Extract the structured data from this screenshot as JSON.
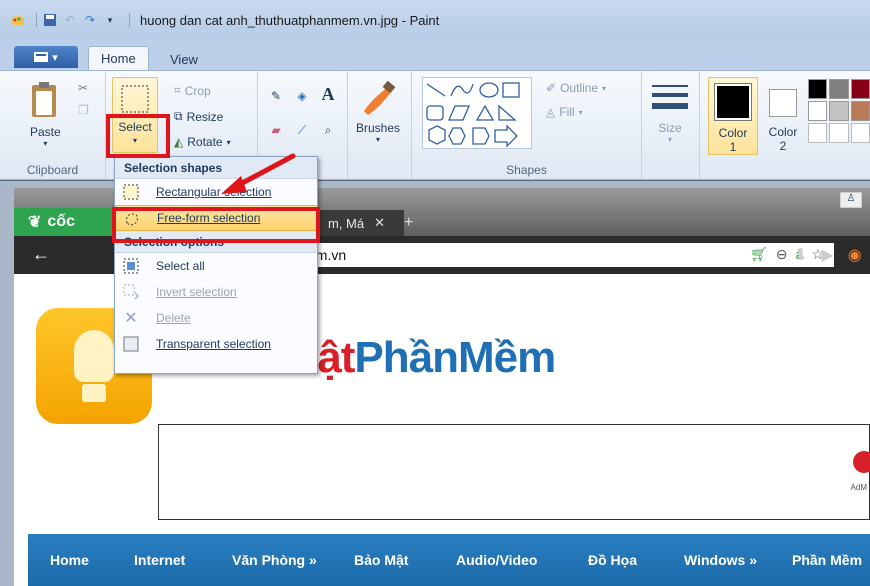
{
  "window": {
    "title": "huong dan cat anh_thuthuatphanmem.vn.jpg - Paint"
  },
  "tabs": {
    "home": "Home",
    "view": "View"
  },
  "ribbon": {
    "clipboard": {
      "paste": "Paste",
      "label": "Clipboard"
    },
    "image": {
      "select": "Select",
      "crop": "Crop",
      "resize": "Resize",
      "rotate": "Rotate"
    },
    "tools": {
      "brushes": "Brushes"
    },
    "shapes": {
      "outline": "Outline",
      "fill": "Fill",
      "label": "Shapes"
    },
    "size": "Size",
    "color1": {
      "label": "Color",
      "num": "1"
    },
    "color2": {
      "label": "Color",
      "num": "2"
    }
  },
  "dropdown": {
    "section1": "Selection shapes",
    "rect": "Rectangular selection",
    "freeform": "Free-form selection",
    "section2": "Selection options",
    "select_all": "Select all",
    "invert": "Invert selection",
    "delete": "Delete",
    "transparent": "Transparent selection"
  },
  "browser": {
    "brand": "cốc",
    "tab_title": "m, Má",
    "address": "em.vn"
  },
  "site": {
    "brand_part1": "ThuThuật",
    "brand_part2": "PhầnMềm",
    "ad_label": "AdM",
    "menu": [
      "Home",
      "Internet",
      "Văn Phòng »",
      "Bảo Mật",
      "Audio/Video",
      "Đồ Họa",
      "Windows »",
      "Phần Mềm"
    ]
  },
  "colors": {
    "accent_red": "#e0151b",
    "ribbon_bg": "#dfe8f4",
    "site_menu": "#1b6aa9"
  }
}
